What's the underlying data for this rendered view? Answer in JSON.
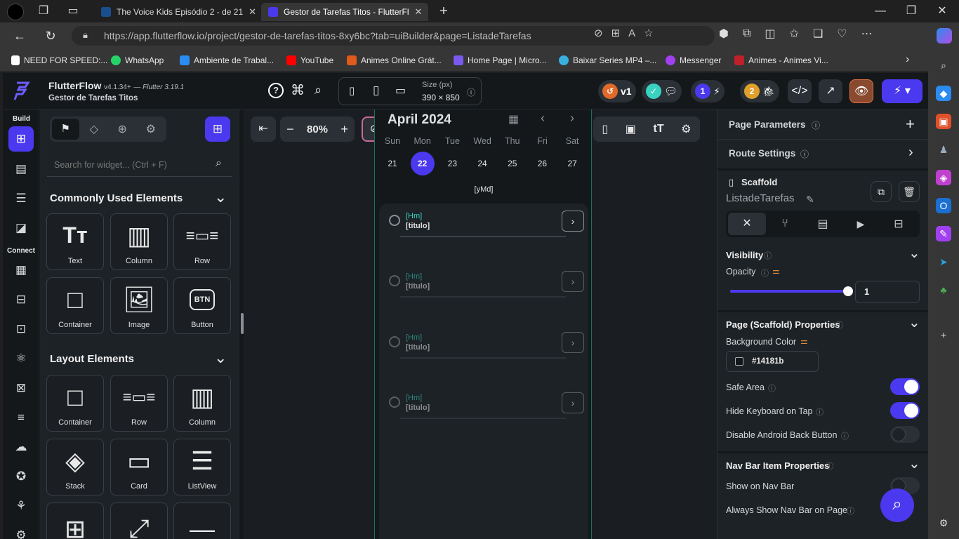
{
  "browser": {
    "tabs": [
      {
        "title": "The Voice Kids Episódio 2 - de 21",
        "active": false
      },
      {
        "title": "Gestor de Tarefas Titos - FlutterFl",
        "active": true
      }
    ],
    "url_host": "https://app.flutterflow.io",
    "url_path": "/project/gestor-de-tarefas-titos-8xy6bc?tab=uiBuilder&page=ListadeTarefas",
    "bookmarks": [
      "NEED FOR SPEED:...",
      "WhatsApp",
      "Ambiente de Trabal...",
      "YouTube",
      "Animes Online Grát...",
      "Home Page | Micro...",
      "Baixar Series MP4 –...",
      "Messenger",
      "Animes - Animes Vi..."
    ]
  },
  "header": {
    "brand": "FlutterFlow",
    "version": "v4.1.34+",
    "flutter": "— Flutter 3.19.1",
    "project": "Gestor de Tarefas Titos",
    "size_label": "Size (px)",
    "size_value": "390 × 850",
    "version_badge": "v1",
    "badge1": "1",
    "badge2": "2"
  },
  "left_rail": {
    "build_label": "Build",
    "connect_label": "Connect"
  },
  "widget_panel": {
    "search_placeholder": "Search for widget... (Ctrl + F)",
    "common_title": "Commonly Used Elements",
    "common_items": [
      "Text",
      "Column",
      "Row",
      "Container",
      "Image",
      "Button"
    ],
    "layout_title": "Layout Elements",
    "layout_items": [
      "Container",
      "Row",
      "Column",
      "Stack",
      "Card",
      "ListView"
    ],
    "btn_glyph": "BTN"
  },
  "canvas": {
    "zoom": "80%",
    "month": "April 2024",
    "weekdays": [
      "Sun",
      "Mon",
      "Tue",
      "Wed",
      "Thu",
      "Fri",
      "Sat"
    ],
    "days": [
      "21",
      "22",
      "23",
      "24",
      "25",
      "26",
      "27"
    ],
    "selected_day": "22",
    "date_format": "[yMd]",
    "tasks": [
      {
        "time": "[Hm]",
        "title": "[titulo]"
      },
      {
        "time": "[Hm]",
        "title": "[titulo]"
      },
      {
        "time": "[Hm]",
        "title": "[titulo]"
      },
      {
        "time": "[Hm]",
        "title": "[titulo]"
      }
    ]
  },
  "properties": {
    "page_parameters": "Page Parameters",
    "route_settings": "Route Settings",
    "widget_type": "Scaffold",
    "page_name": "ListadeTarefas",
    "visibility": "Visibility",
    "opacity_label": "Opacity",
    "opacity_value": "1",
    "opacity_fraction": 1.0,
    "scaffold_props": "Page (Scaffold) Properties",
    "bg_color_label": "Background Color",
    "bg_color_value": "#14181b",
    "safe_area": "Safe Area",
    "safe_area_on": true,
    "hide_keyboard": "Hide Keyboard on Tap",
    "hide_keyboard_on": true,
    "disable_back": "Disable Android Back Button",
    "disable_back_on": false,
    "navbar_props": "Nav Bar Item Properties",
    "show_navbar": "Show on Nav Bar",
    "always_show_navbar": "Always Show Nav Bar on Page"
  },
  "colors": {
    "accent": "#4b39ef",
    "teal": "#39d2c0",
    "bg": "#14181b",
    "panel": "#1d2226"
  }
}
